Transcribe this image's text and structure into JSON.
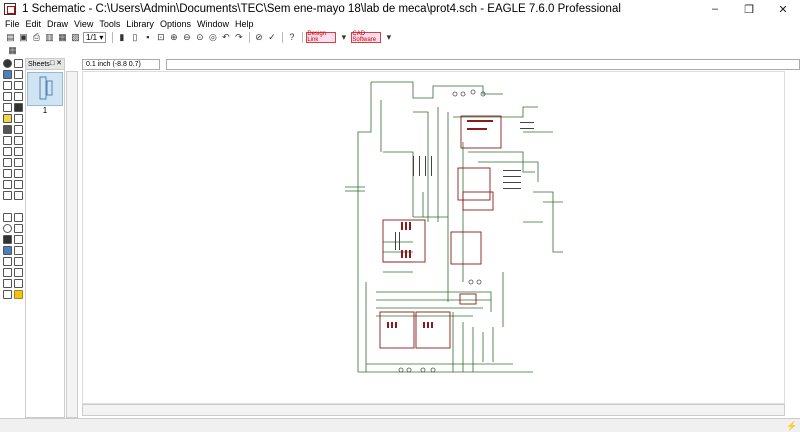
{
  "window": {
    "title": "1 Schematic - C:\\Users\\Admin\\Documents\\TEC\\Sem ene-mayo 18\\lab de meca\\prot4.sch - EAGLE 7.6.0 Professional",
    "minimize": "–",
    "maximize": "❐",
    "close": "✕"
  },
  "menu": [
    "File",
    "Edit",
    "Draw",
    "View",
    "Tools",
    "Library",
    "Options",
    "Window",
    "Help"
  ],
  "toolbar": {
    "sheet_combo": "1/1",
    "brand1": "Design Link",
    "brand2": "CAD Software"
  },
  "sheets": {
    "header": "Sheets",
    "controls": "□ ✕",
    "items": [
      {
        "label": "1"
      }
    ]
  },
  "command": {
    "coords": "0.1 inch (-8.8 0.7)"
  },
  "colors": {
    "wire": "#2f6b2f",
    "part": "#8b1a1a",
    "text": "#444444"
  }
}
